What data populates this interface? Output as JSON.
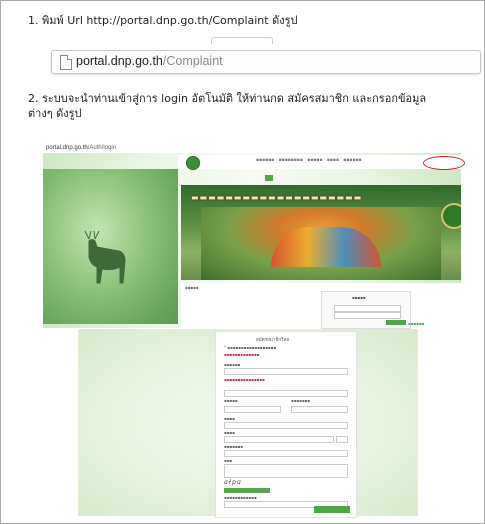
{
  "step1": {
    "text": "1. พิมพ์ Url  http://portal.dnp.go.th/Complaint ดังรูป"
  },
  "address_bar": {
    "host": "portal.dnp.go.th",
    "path": "/Complaint"
  },
  "step2": {
    "text": "2. ระบบจะนำท่านเข้าสู่การ login อัตโนมัติ ให้ท่านกด สมัครสมาชิก และกรอกข้อมูลต่างๆ ดังรูป"
  },
  "screenshot": {
    "url_host": "portal.dnp.go.th",
    "url_path": "/Auth/login",
    "form_title": "สมัครสมาชิกใหม่"
  },
  "colors": {
    "highlight_circle": "#d02020",
    "site_green": "#4ea645"
  }
}
